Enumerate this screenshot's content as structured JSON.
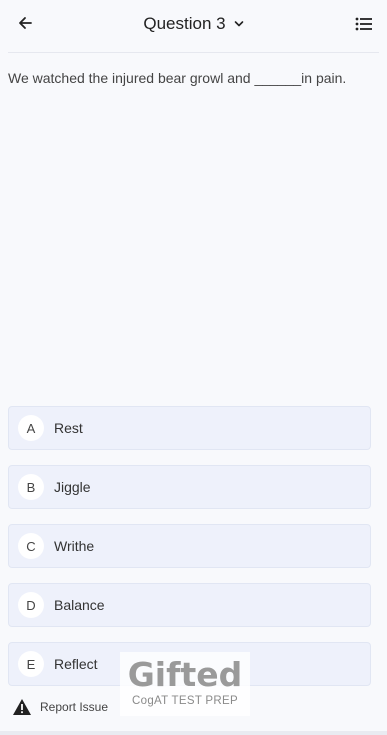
{
  "header": {
    "title": "Question 3",
    "back_icon": "arrow-left-icon",
    "dropdown_icon": "chevron-down-icon",
    "list_icon": "list-icon"
  },
  "question": {
    "text": "We watched the injured bear growl and ______in pain."
  },
  "options": [
    {
      "letter": "A",
      "text": "Rest"
    },
    {
      "letter": "B",
      "text": "Jiggle"
    },
    {
      "letter": "C",
      "text": "Writhe"
    },
    {
      "letter": "D",
      "text": "Balance"
    },
    {
      "letter": "E",
      "text": "Reflect"
    }
  ],
  "footer": {
    "report_label": "Report Issue",
    "report_icon": "warning-icon"
  },
  "logo": {
    "word": "Gifted",
    "subtitle": "CogAT TEST PREP"
  },
  "colors": {
    "background": "#f8f9fc",
    "option_bg": "#eef1fb",
    "option_border": "#e1e6f3"
  }
}
